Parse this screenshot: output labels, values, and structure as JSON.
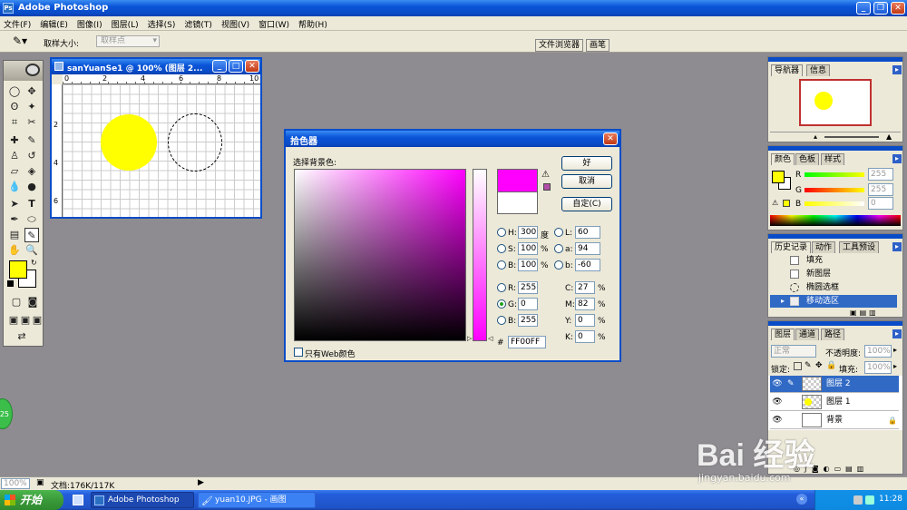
{
  "app": {
    "title": "Adobe Photoshop",
    "colors": {
      "fg": "#ffff00",
      "bg": "#ff00ff"
    }
  },
  "menu": [
    "文件(F)",
    "编辑(E)",
    "图像(I)",
    "图层(L)",
    "选择(S)",
    "滤镜(T)",
    "视图(V)",
    "窗口(W)",
    "帮助(H)"
  ],
  "options": {
    "sample_label": "取样大小:",
    "sample_value": "取样点",
    "tab_browser": "文件浏览器",
    "tab_brush": "画笔"
  },
  "doc": {
    "title": "sanYuanSe1 @ 100% (图层 2...",
    "ruler_top": [
      "0",
      "2",
      "4",
      "6",
      "8",
      "10"
    ],
    "ruler_left": [
      "2",
      "4",
      "6"
    ]
  },
  "picker": {
    "title": "拾色器",
    "prompt": "选择背景色:",
    "ok": "好",
    "cancel": "取消",
    "custom": "自定(C)",
    "web_only": "只有Web颜色",
    "hsb": [
      {
        "label": "H:",
        "value": "300",
        "unit": "度"
      },
      {
        "label": "S:",
        "value": "100",
        "unit": "%"
      },
      {
        "label": "B:",
        "value": "100",
        "unit": "%"
      }
    ],
    "lab": [
      {
        "label": "L:",
        "value": "60"
      },
      {
        "label": "a:",
        "value": "94"
      },
      {
        "label": "b:",
        "value": "-60"
      }
    ],
    "rgb": [
      {
        "label": "R:",
        "value": "255"
      },
      {
        "label": "G:",
        "value": "0"
      },
      {
        "label": "B:",
        "value": "255"
      }
    ],
    "cmyk": [
      {
        "label": "C:",
        "value": "27",
        "unit": "%"
      },
      {
        "label": "M:",
        "value": "82",
        "unit": "%"
      },
      {
        "label": "Y:",
        "value": "0",
        "unit": "%"
      },
      {
        "label": "K:",
        "value": "0",
        "unit": "%"
      }
    ],
    "hash": "#",
    "hex": "FF00FF",
    "new_color": "#ff00ff",
    "old_color": "#ffffff"
  },
  "navigator": {
    "tabs": [
      "导航器",
      "信息"
    ]
  },
  "color_panel": {
    "tabs": [
      "颜色",
      "色板",
      "样式"
    ],
    "rows": [
      {
        "label": "R",
        "value": "255"
      },
      {
        "label": "G",
        "value": "255"
      },
      {
        "label": "B",
        "value": "0"
      }
    ]
  },
  "history": {
    "tabs": [
      "历史记录",
      "动作",
      "工具预设"
    ],
    "items": [
      "填充",
      "新图层",
      "椭圆选框",
      "移动选区"
    ]
  },
  "layers": {
    "tabs": [
      "图层",
      "通道",
      "路径"
    ],
    "blend": "正常",
    "opacity_label": "不透明度:",
    "opacity": "100%",
    "lock_label": "锁定:",
    "fill_label": "填充:",
    "fill": "100%",
    "items": [
      "图层 2",
      "图层 1",
      "背景"
    ]
  },
  "status": {
    "zoom": "100%",
    "doc": "文档:176K/117K"
  },
  "taskbar": {
    "start": "开始",
    "tasks": [
      "Adobe Photoshop",
      "yuan10.JPG - 画图"
    ],
    "time": "11:28",
    "badge": "25"
  },
  "watermark": {
    "logo": "Bai 经验",
    "url": "jingyan.baidu.com"
  }
}
